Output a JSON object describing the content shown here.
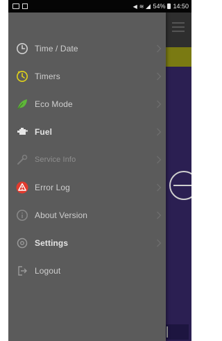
{
  "status_bar": {
    "battery_percent": "54%",
    "time": "14:50"
  },
  "drawer": {
    "items": [
      {
        "label": "Time / Date",
        "icon": "clock-icon",
        "chevron": true
      },
      {
        "label": "Timers",
        "icon": "timer-icon",
        "chevron": true
      },
      {
        "label": "Eco Mode",
        "icon": "leaf-icon",
        "chevron": true
      },
      {
        "label": "Fuel",
        "icon": "fuel-icon",
        "chevron": true
      },
      {
        "label": "Service Info",
        "icon": "wrench-icon",
        "chevron": true
      },
      {
        "label": "Error Log",
        "icon": "warning-icon",
        "chevron": true
      },
      {
        "label": "About Version",
        "icon": "info-icon",
        "chevron": true
      },
      {
        "label": "Settings",
        "icon": "gear-icon",
        "chevron": true
      },
      {
        "label": "Logout",
        "icon": "logout-icon",
        "chevron": false
      }
    ]
  },
  "colors": {
    "drawer_bg": "#5b5b5b",
    "timer_icon": "#e0d21a",
    "eco_icon": "#5fb63a",
    "error_icon": "#e23b2e",
    "app_accent_bar": "#7a7a12",
    "app_bg": "#2b1f52"
  }
}
